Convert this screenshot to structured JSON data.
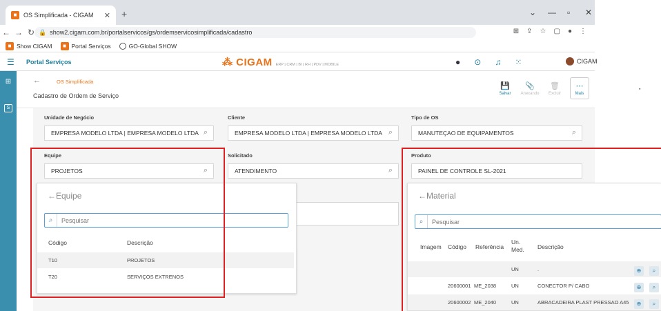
{
  "browser": {
    "tab_title": "OS Simplificada - CIGAM",
    "url": "show2.cigam.com.br/portalservicos/gs/ordemservicosimplificada/cadastro",
    "bookmarks": [
      "Show CIGAM",
      "Portal Serviços",
      "GO-Global SHOW"
    ]
  },
  "header": {
    "portal_title": "Portal Serviços",
    "logo": "CIGAM",
    "logo_sub": "ERP | CRM | BI | RH | PDV | MOBILE",
    "user": "CIGAM"
  },
  "page": {
    "breadcrumb": "OS Simplificada",
    "title": "Cadastro de Ordem de Serviço",
    "toolbar": {
      "save": "Salvar",
      "attach": "Anexando",
      "delete": "Excluir",
      "more": "Mais"
    }
  },
  "form": {
    "unidade_label": "Unidade de Negócio",
    "unidade_value": "EMPRESA MODELO LTDA | EMPRESA MODELO LTDA",
    "cliente_label": "Cliente",
    "cliente_value": "EMPRESA MODELO LTDA | EMPRESA MODELO LTDA",
    "tipo_label": "Tipo de OS",
    "tipo_value": "MANUTEÇAO DE EQUIPAMENTOS",
    "equipe_label": "Equipe",
    "equipe_value": "PROJETOS",
    "solicitado_label": "Solicitado",
    "solicitado_value": "ATENDIMENTO",
    "produto_label": "Produto",
    "produto_value": "PAINEL DE CONTROLE SL-2021"
  },
  "equipe_popup": {
    "title": "Equipe",
    "search_placeholder": "Pesquisar",
    "columns": [
      "Código",
      "Descrição"
    ],
    "rows": [
      {
        "codigo": "T10",
        "descricao": "PROJETOS"
      },
      {
        "codigo": "T20",
        "descricao": "SERVIÇOS EXTRENOS"
      }
    ]
  },
  "material_popup": {
    "title": "Material",
    "search_placeholder": "Pesquisar",
    "columns": [
      "Imagem",
      "Código",
      "Referência",
      "Un. Med.",
      "Descrição"
    ],
    "rows": [
      {
        "codigo": "",
        "referencia": "",
        "un": "UN",
        "descricao": "."
      },
      {
        "codigo": "20600001",
        "referencia": "ME_2038",
        "un": "UN",
        "descricao": "CONECTOR P/ CABO"
      },
      {
        "codigo": "20600002",
        "referencia": "ME_2040",
        "un": "UN",
        "descricao": "ABRACADEIRA PLAST PRESSAO A45"
      }
    ]
  },
  "colors": {
    "accent": "#1e7f9e",
    "brand": "#e8731a",
    "sidebar": "#3a8fae",
    "highlight": "#e02020"
  }
}
